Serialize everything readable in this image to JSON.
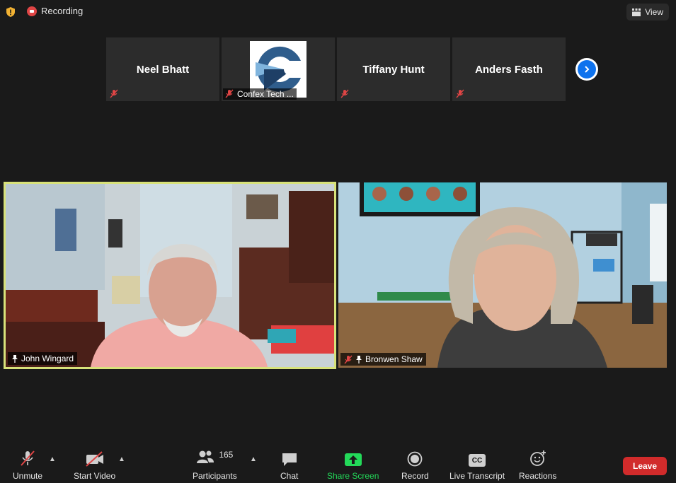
{
  "topbar": {
    "recording_label": "Recording",
    "view_label": "View"
  },
  "thumbnails": [
    {
      "name": "Neel Bhatt",
      "muted": true
    },
    {
      "name": "Confex Tech ...",
      "muted": true,
      "has_logo": true
    },
    {
      "name": "Tiffany Hunt",
      "muted": true
    },
    {
      "name": "Anders Fasth",
      "muted": true
    }
  ],
  "videos": {
    "john": {
      "name": "John Wingard",
      "active_speaker_color": "#d8e27a"
    },
    "bronwen": {
      "name": "Bronwen Shaw",
      "muted": true
    }
  },
  "toolbar": {
    "unmute": "Unmute",
    "start_video": "Start Video",
    "participants": "Participants",
    "participants_count": "165",
    "chat": "Chat",
    "share_screen": "Share Screen",
    "record": "Record",
    "live_transcript": "Live Transcript",
    "cc_badge": "CC",
    "reactions": "Reactions",
    "leave": "Leave"
  },
  "colors": {
    "background": "#1a1a1a",
    "share_green": "#23d959",
    "leave_red": "#d12b2b",
    "accent_blue": "#0e72ed"
  }
}
